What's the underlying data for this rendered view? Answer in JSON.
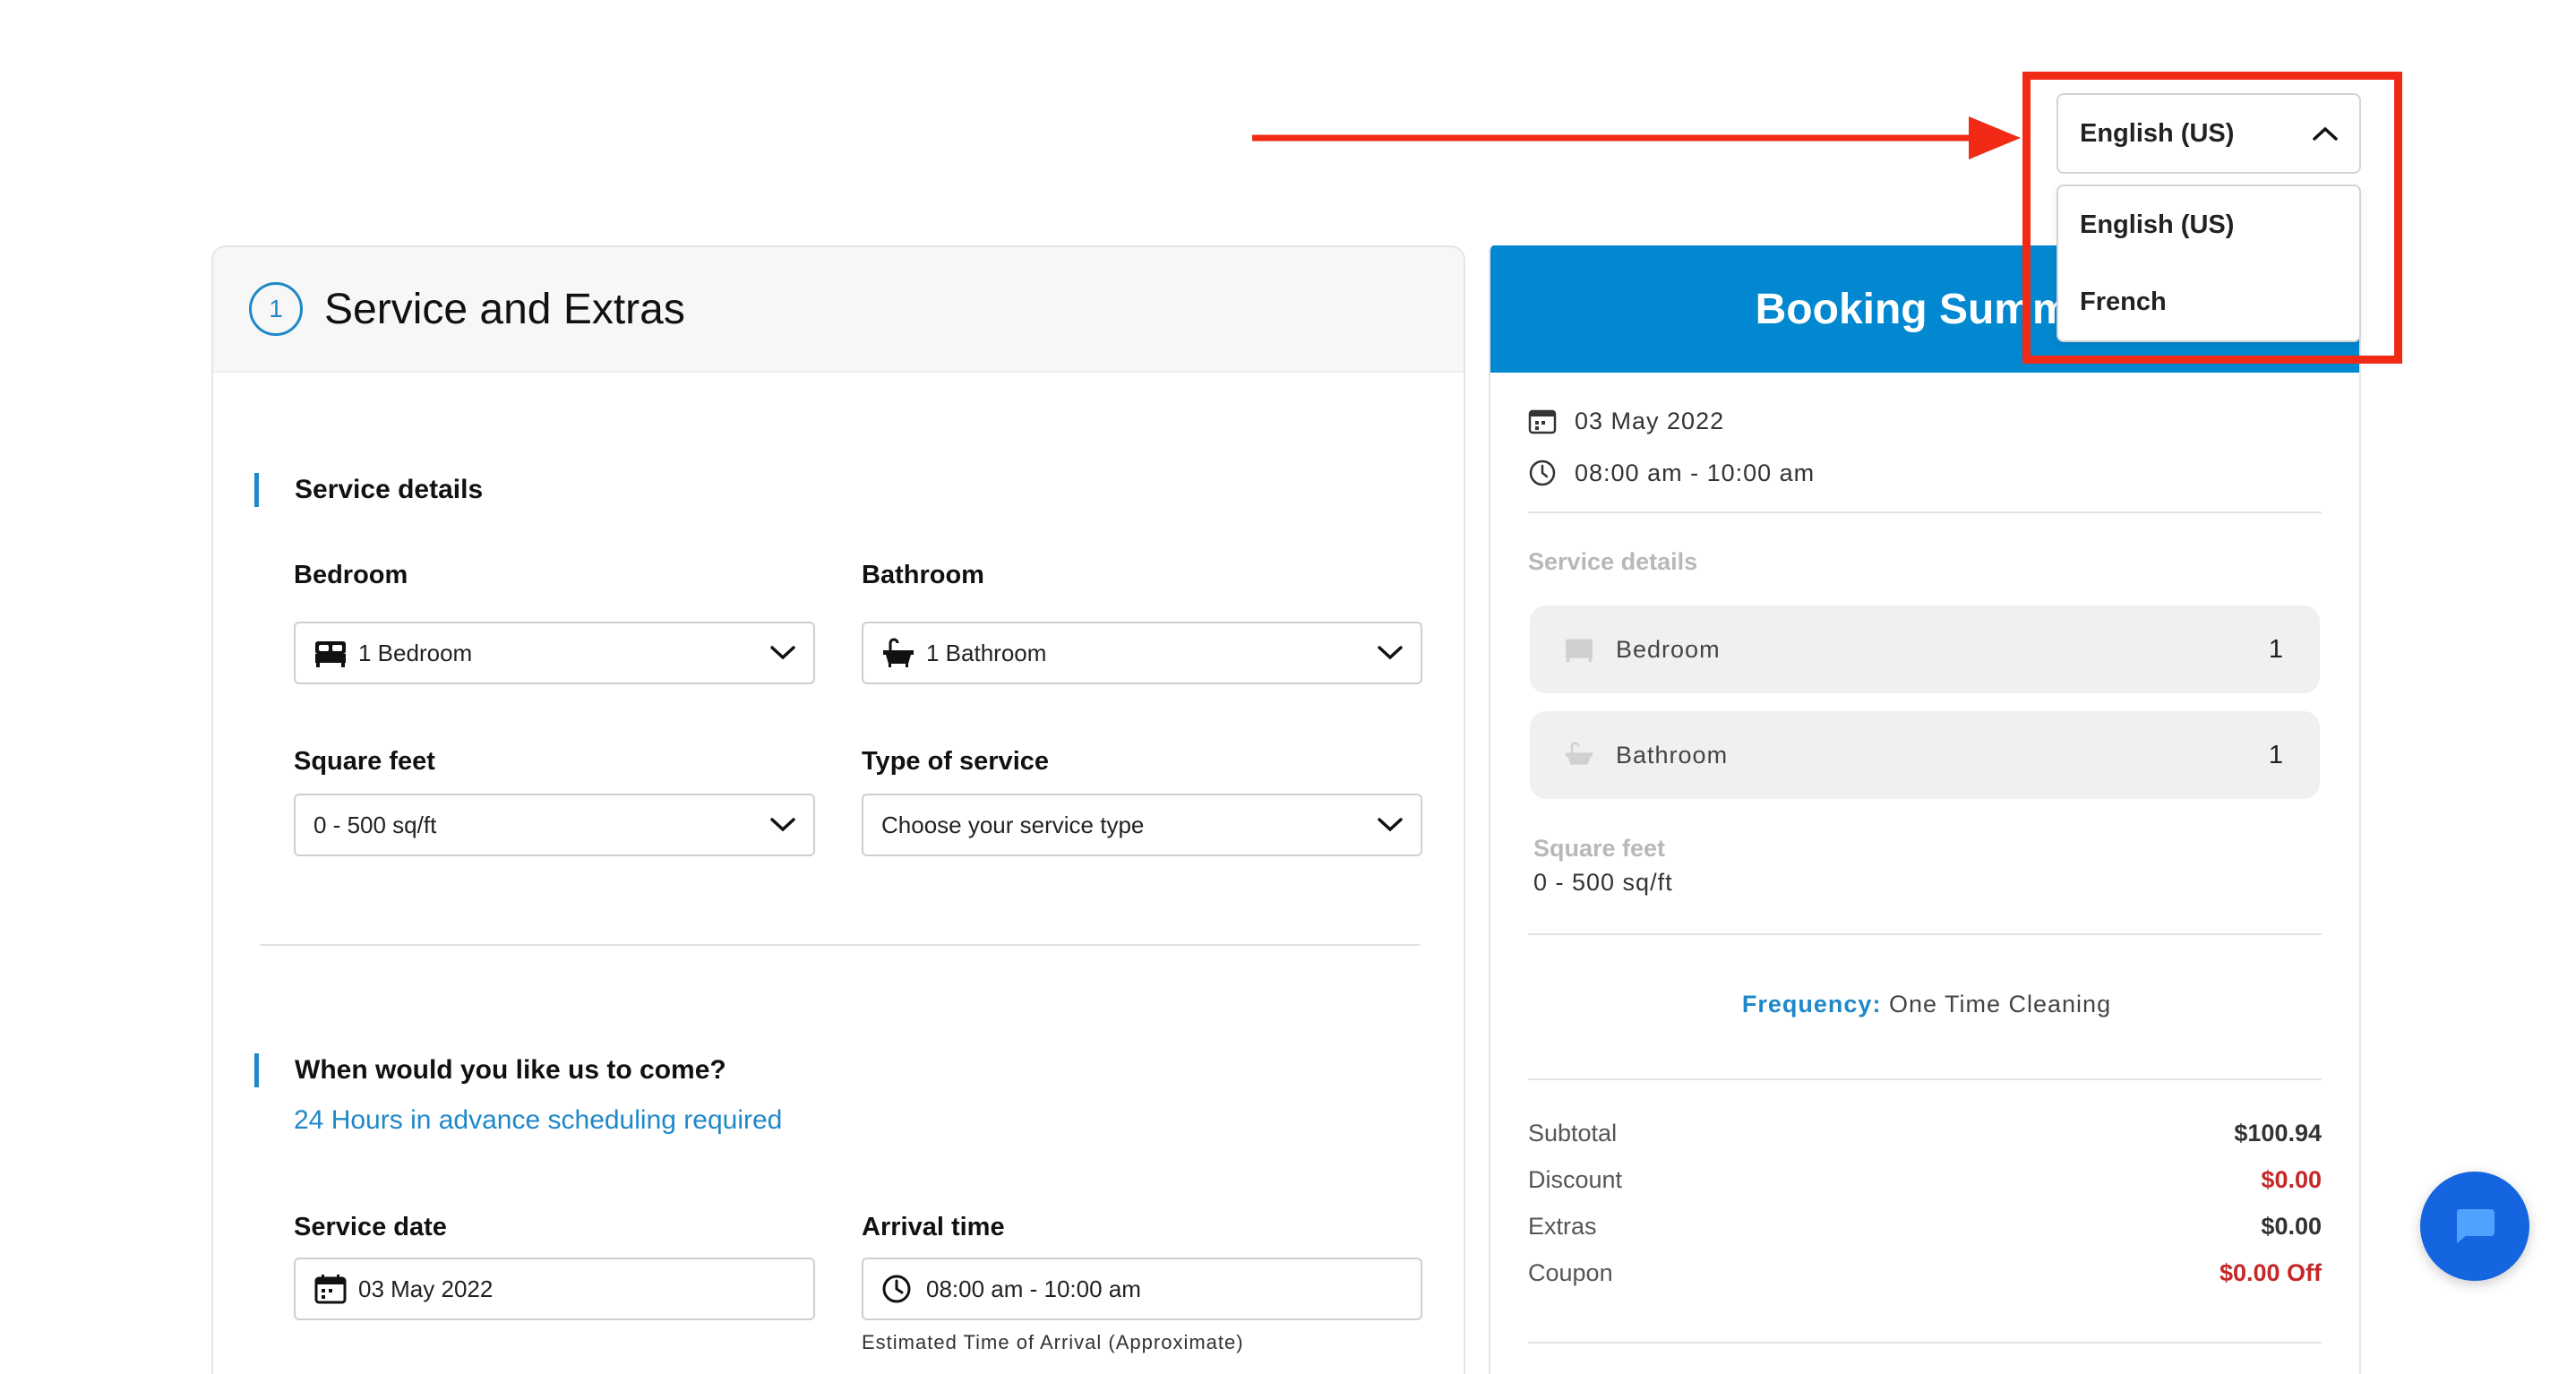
{
  "language": {
    "selected": "English (US)",
    "options": [
      "English (US)",
      "French"
    ]
  },
  "left": {
    "step_number": "1",
    "title": "Service and Extras",
    "service_details_label": "Service details",
    "bedroom_label": "Bedroom",
    "bedroom_value": "1 Bedroom",
    "bathroom_label": "Bathroom",
    "bathroom_value": "1 Bathroom",
    "sqft_label": "Square feet",
    "sqft_value": "0 - 500 sq/ft",
    "service_type_label": "Type of service",
    "service_type_value": "Choose your service type",
    "schedule_label": "When would you like us to come?",
    "schedule_note": "24 Hours in advance scheduling required",
    "date_label": "Service date",
    "date_value": "03 May 2022",
    "arrival_label": "Arrival time",
    "arrival_value": "08:00 am - 10:00 am",
    "arrival_note": "Estimated Time of Arrival (Approximate)"
  },
  "summary": {
    "title": "Booking Summa",
    "date": "03 May 2022",
    "time": "08:00 am - 10:00 am",
    "service_details_label": "Service details",
    "items": [
      {
        "label": "Bedroom",
        "count": "1"
      },
      {
        "label": "Bathroom",
        "count": "1"
      }
    ],
    "sqft_label": "Square feet",
    "sqft_value": "0 - 500 sq/ft",
    "frequency_key": "Frequency:",
    "frequency_value": "One Time Cleaning",
    "rows": [
      {
        "label": "Subtotal",
        "amount": "$100.94"
      },
      {
        "label": "Discount",
        "amount": "$0.00"
      },
      {
        "label": "Extras",
        "amount": "$0.00"
      },
      {
        "label": "Coupon",
        "amount": "$0.00 Off"
      }
    ]
  },
  "colors": {
    "accent": "#1e88c8",
    "header_blue": "#0288d1",
    "annotation_red": "#f02a15",
    "negative_red": "#c62828",
    "chat_button": "#1565e0"
  },
  "icons": [
    "bed-icon",
    "bathtub-icon",
    "calendar-icon",
    "clock-icon",
    "chevron-down-icon",
    "chevron-up-icon",
    "chat-icon",
    "annotation-arrow"
  ]
}
